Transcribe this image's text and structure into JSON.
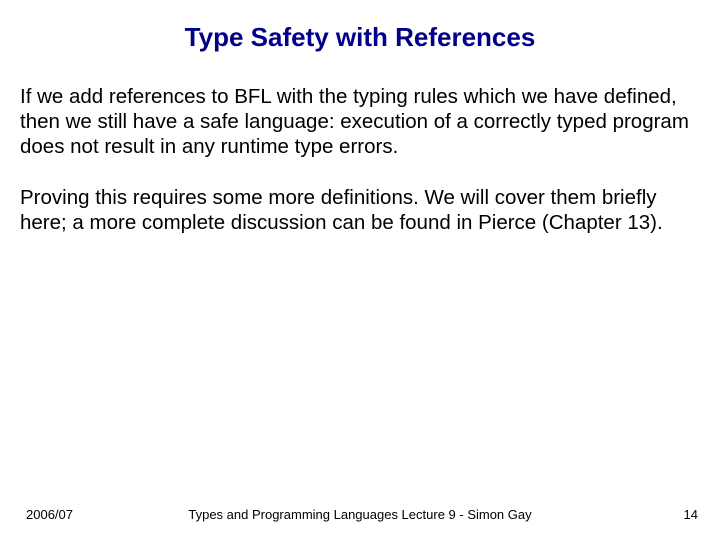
{
  "title": "Type Safety with References",
  "paragraphs": [
    "If we add references to BFL with the typing rules which we have defined, then we still have a safe language: execution of a correctly typed program does not result in any runtime type errors.",
    "Proving this requires some more definitions. We will cover them briefly here; a more complete discussion can be found in Pierce (Chapter 13)."
  ],
  "footer": {
    "left": "2006/07",
    "center": "Types and Programming Languages Lecture 9 - Simon Gay",
    "right": "14"
  }
}
